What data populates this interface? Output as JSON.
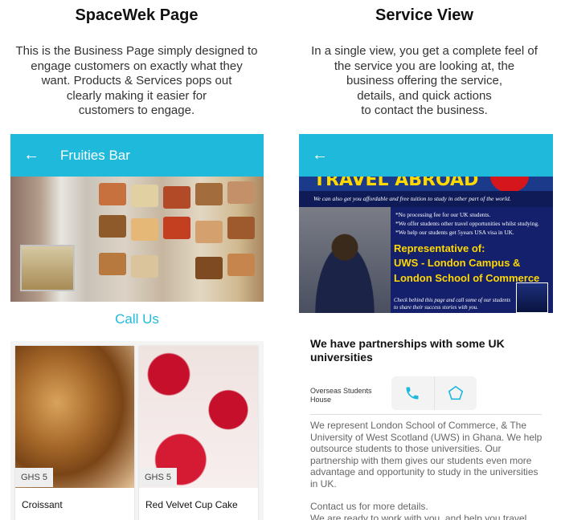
{
  "left": {
    "heading": "SpaceWek Page",
    "description": "This is the Business Page simply designed to\nengage customers on exactly what they\nwant. Products & Services pops out\nclearly making it easier for\ncustomers to engage.",
    "appbar": {
      "back_icon": "←",
      "title": "Fruities Bar"
    },
    "call_us": "Call Us",
    "products": [
      {
        "name": "Croissant",
        "price": "GHS 5"
      },
      {
        "name": "Red Velvet Cup Cake",
        "price": "GHS 5"
      }
    ]
  },
  "right": {
    "heading": "Service View",
    "description": "In a single view, you get a complete feel of\nthe service you are looking at, the\nbusiness offering the service,\ndetails, and quick actions\nto contact the business.",
    "appbar": {
      "back_icon": "←"
    },
    "banner": {
      "headline": "TRAVEL ABROAD",
      "strip": "We can also get you affordable and free tuition to study in other part of the world.",
      "bullets": [
        "*No processing fee for our UK students.",
        "*We offer students other travel opportunities whilst studying.",
        "*We help our students get 5years USA visa in UK."
      ],
      "rep_1": "Representative of:",
      "rep_2": "UWS - London Campus &",
      "rep_3": "London School of Commerce",
      "check": "Check behind this page and call some of our students to share their success stories with you."
    },
    "service_title": "We have partnerships with some UK universities",
    "provider": "Overseas Students House",
    "actions": [
      "phone-icon",
      "pentagon-icon"
    ],
    "body": [
      "We represent London School of Commerce, & The University of West Scotland (UWS) in Ghana. We help outsource students to those universities. Our partnership with them gives our students even more advantage and opportunity to study in the universities in UK.",
      "Contact us for more details.",
      "We are ready to work with you, and help you travel"
    ],
    "accent": "#1fb9dc"
  }
}
